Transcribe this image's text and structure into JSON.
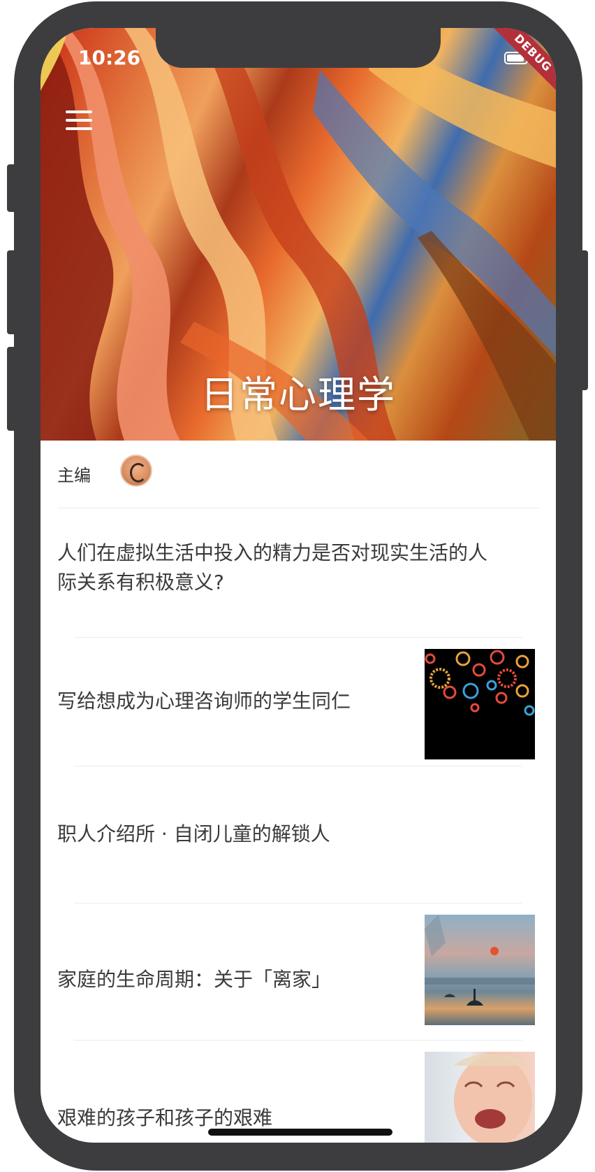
{
  "status_bar": {
    "time": "10:26",
    "debug_label": "DEBUG"
  },
  "header": {
    "title": "日常心理学",
    "menu_icon": "menu-icon"
  },
  "editor": {
    "label": "主编",
    "avatar": "avatar"
  },
  "articles": [
    {
      "title": "人们在虚拟生活中投入的精力是否对现实生活的人际关系有积极意义?",
      "thumbnail": ""
    },
    {
      "title": "写给想成为心理咨询师的学生同仁",
      "thumbnail": "gears-image"
    },
    {
      "title": "职人介绍所 · 自闭儿童的解锁人",
      "thumbnail": ""
    },
    {
      "title": "家庭的生命周期：关于「离家」",
      "thumbnail": "harbor-painting-image"
    },
    {
      "title": "艰难的孩子和孩子的艰难",
      "thumbnail": "crying-baby-image"
    }
  ],
  "colors": {
    "frame": "#3d3d3f",
    "debug_banner": "#b3303a",
    "text": "#3b3b3b",
    "divider": "#ececec"
  }
}
